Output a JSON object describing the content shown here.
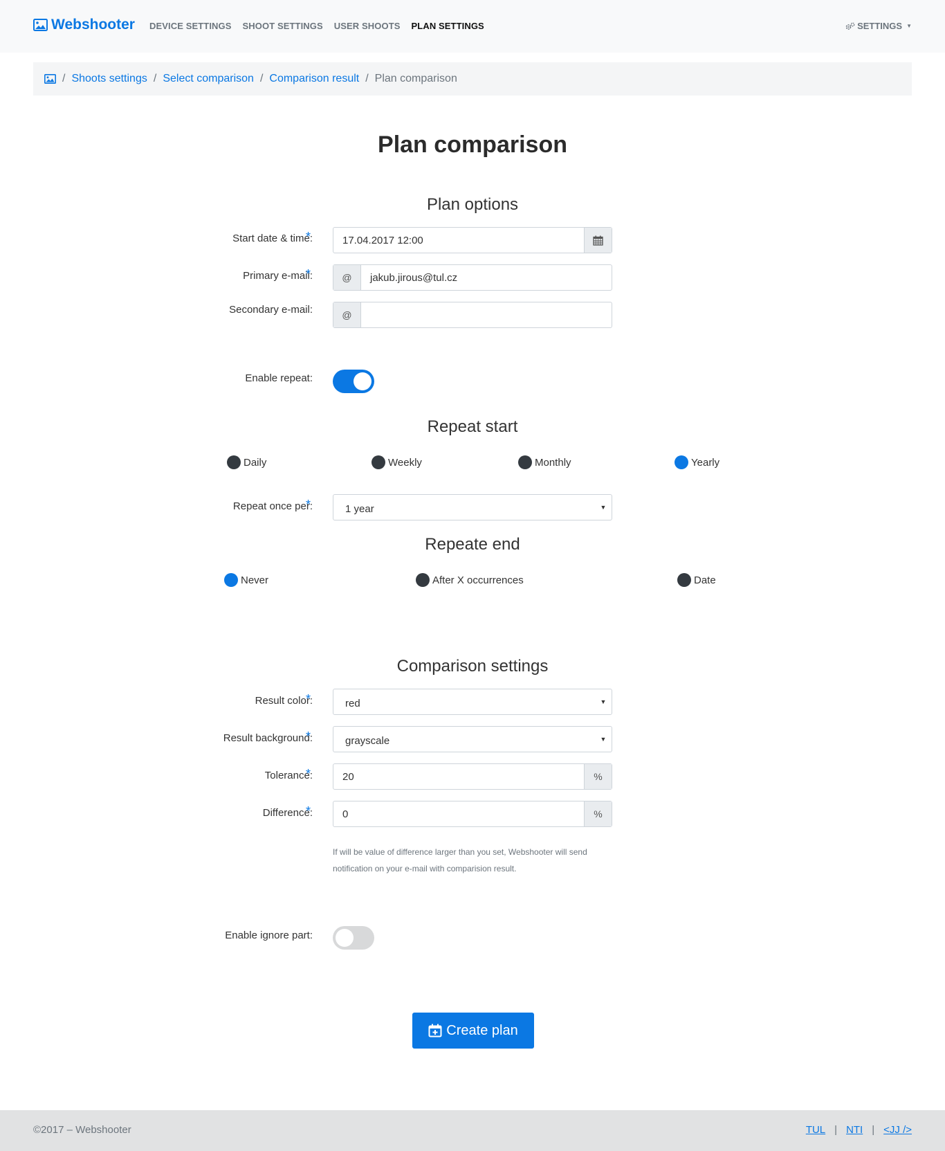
{
  "navbar": {
    "brand": "Webshooter",
    "links": [
      "DEVICE SETTINGS",
      "SHOOT SETTINGS",
      "USER SHOOTS",
      "PLAN SETTINGS"
    ],
    "settings": "SETTINGS"
  },
  "breadcrumb": {
    "items": [
      "Shoots settings",
      "Select comparison",
      "Comparison result"
    ],
    "current": "Plan comparison"
  },
  "page_title": "Plan comparison",
  "plan_options": {
    "title": "Plan options",
    "start_label": "Start date & time:",
    "start_value": "17.04.2017 12:00",
    "primary_label": "Primary e-mail:",
    "primary_value": "jakub.jirous@tul.cz",
    "secondary_label": "Secondary e-mail:",
    "secondary_value": "",
    "at": "@",
    "required_mark": "*"
  },
  "repeat": {
    "enable_label": "Enable repeat:",
    "enabled": true,
    "start_title": "Repeat start",
    "start_options": [
      "Daily",
      "Weekly",
      "Monthly",
      "Yearly"
    ],
    "start_selected": "Yearly",
    "once_per_label": "Repeat once per:",
    "once_per_value": "1 year",
    "end_title": "Repeate end",
    "end_options": [
      "Never",
      "After X occurrences",
      "Date"
    ],
    "end_selected": "Never"
  },
  "comparison": {
    "title": "Comparison settings",
    "color_label": "Result color:",
    "color_value": "red",
    "background_label": "Result background:",
    "background_value": "grayscale",
    "tolerance_label": "Tolerance:",
    "tolerance_value": "20",
    "difference_label": "Difference:",
    "difference_value": "0",
    "percent": "%",
    "help_text": "If will be value of difference larger than you set, Webshooter will send notification on your e-mail with comparision result."
  },
  "ignore": {
    "label": "Enable ignore part:",
    "enabled": false
  },
  "create_button": "Create plan",
  "footer": {
    "copyright": "©2017 – Webshooter",
    "links": [
      "TUL",
      "NTI",
      "<JJ />"
    ],
    "separator": "|"
  },
  "colors": {
    "accent": "#0b78e3",
    "navbar_bg": "#f8f9fa",
    "footer_bg": "#e1e2e3",
    "radio_unchecked": "#343a40"
  }
}
